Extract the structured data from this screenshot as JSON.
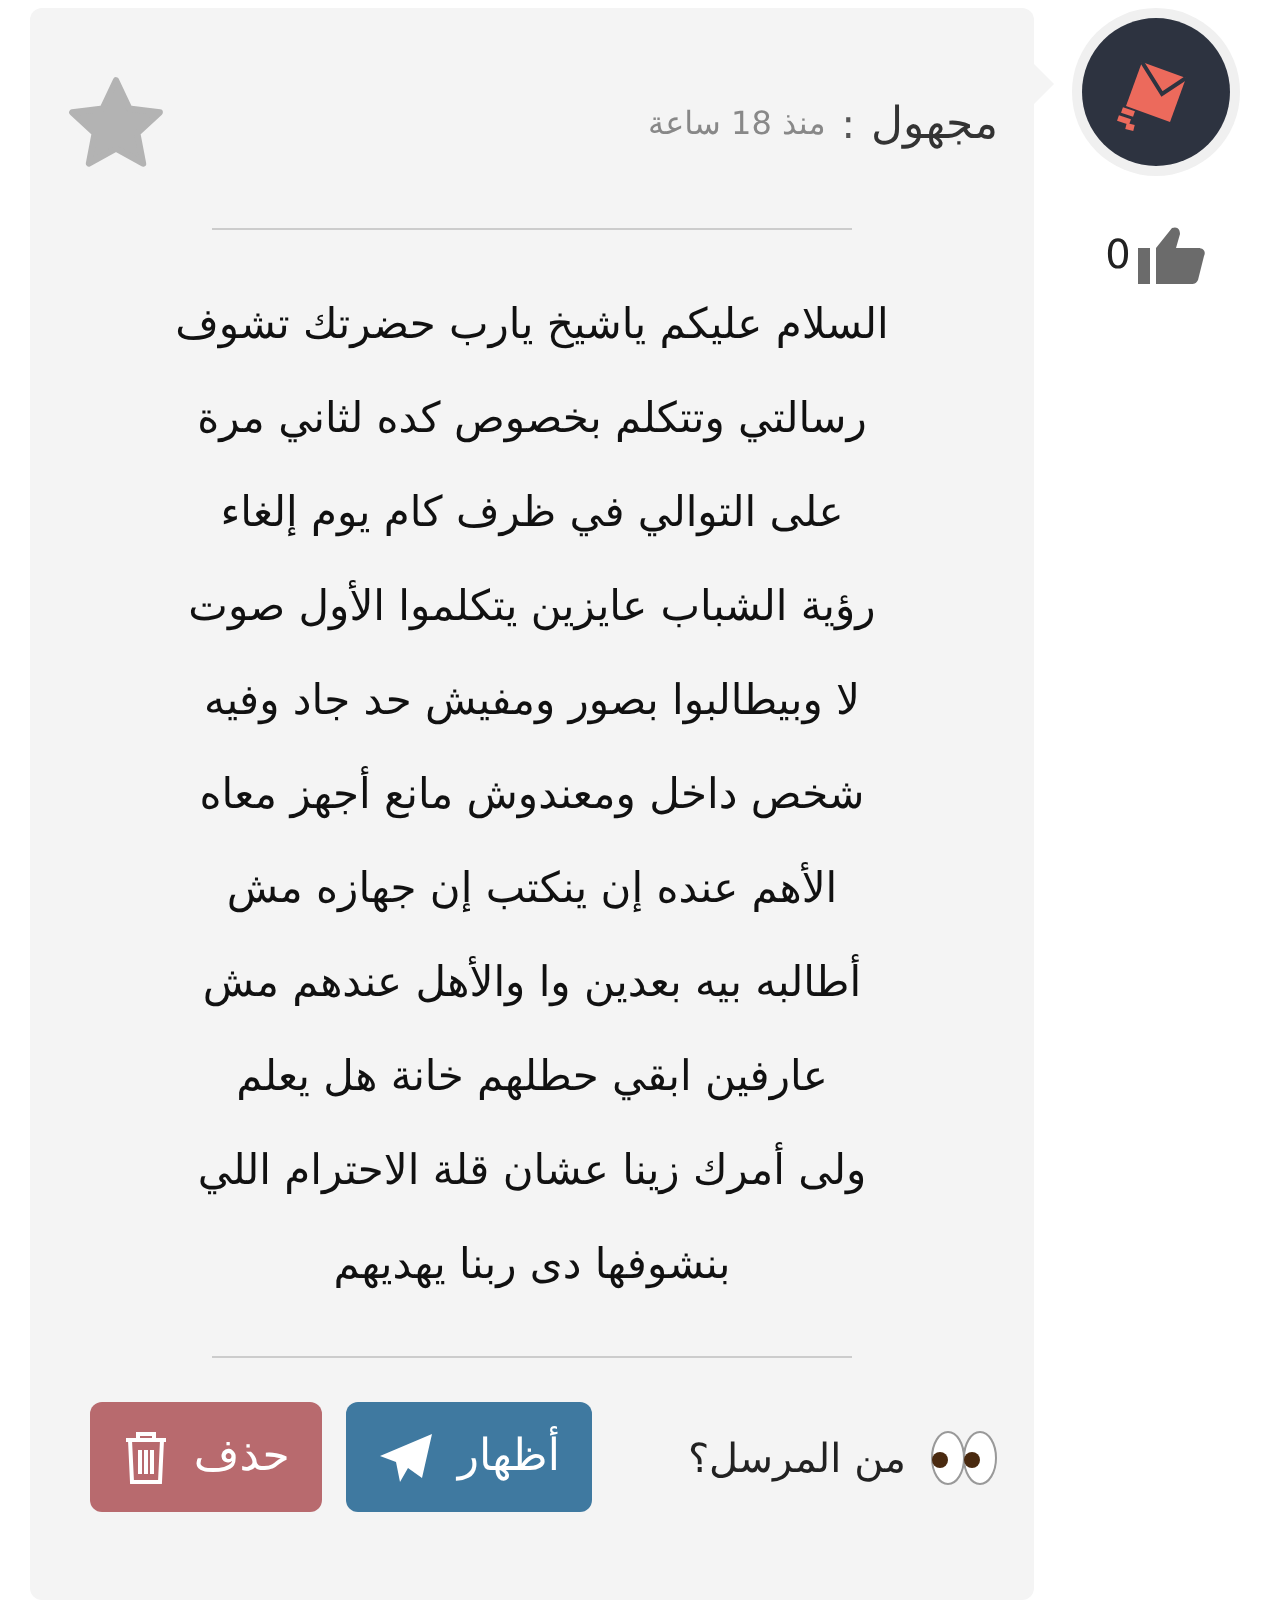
{
  "post": {
    "author": "مجهول",
    "separator": ":",
    "time": "منذ 18 ساعة",
    "message": "السلام عليكم ياشيخ يارب حضرتك تشوف\nرسالتي وتتكلم بخصوص كده لثاني مرة\nعلى التوالي في ظرف كام يوم إلغاء\nرؤية الشباب عايزين يتكلموا الأول صوت\nلا وبيطالبوا بصور ومفيش حد جاد وفيه\nشخص داخل ومعندوش مانع أجهز معاه\nالأهم عنده إن ينكتب إن جهازه مش\nأطالبه بيه بعدين وا والأهل عندهم مش\nعارفين ابقي حطلهم خانة هل يعلم\nولى أمرك زينا عشان قلة الاحترام اللي\nبنشوفها دى ربنا يهديهم",
    "sender_question": "من المرسل؟",
    "buttons": [
      {
        "kind": "reveal",
        "label": "أظهار"
      },
      {
        "kind": "delete",
        "label": "حذف"
      }
    ]
  },
  "likes": {
    "count": "0"
  }
}
